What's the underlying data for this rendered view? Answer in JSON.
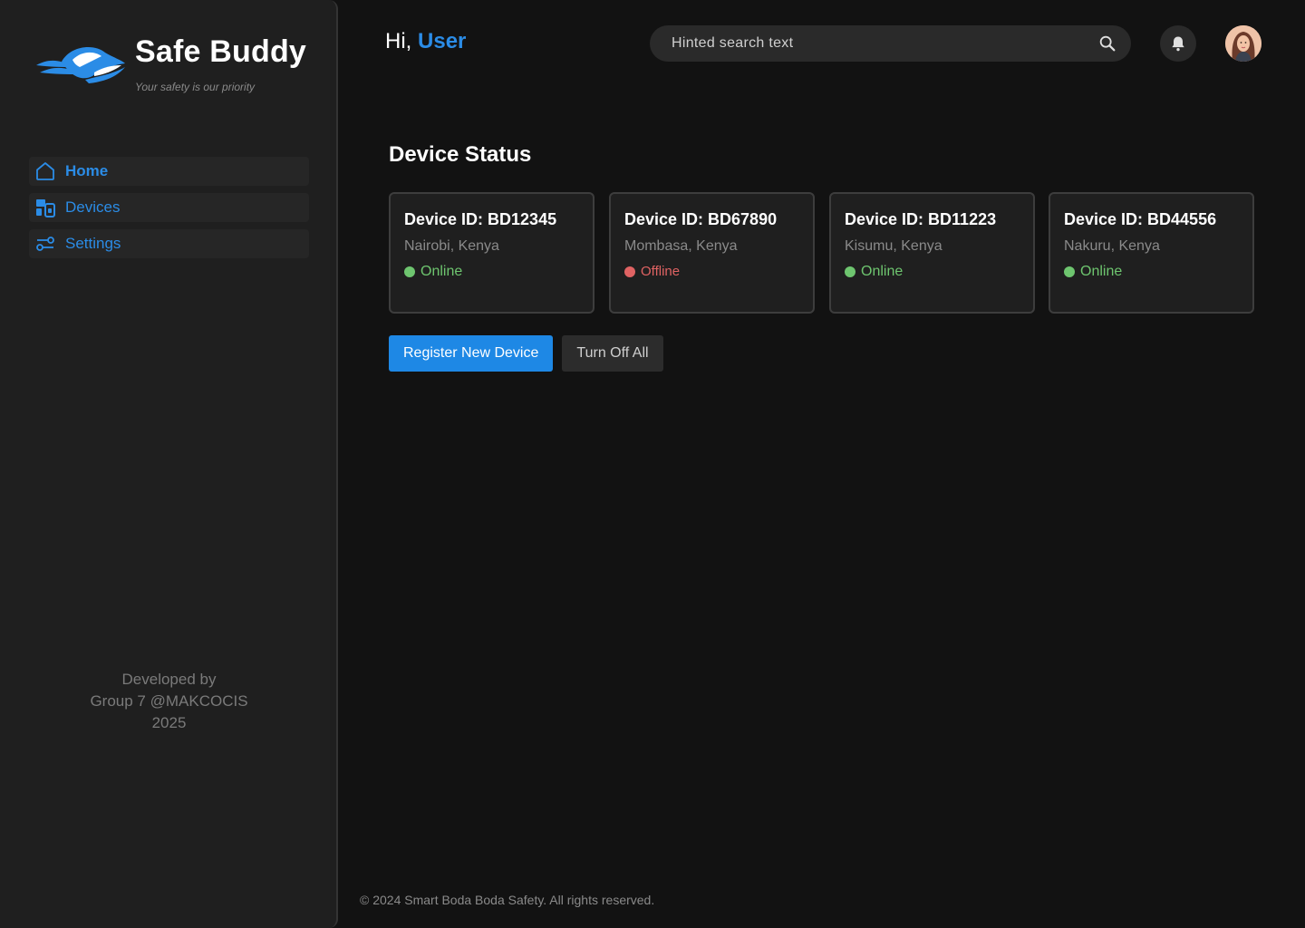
{
  "brand": {
    "name": "Safe Buddy",
    "tagline": "Your safety is our priority"
  },
  "sidebar": {
    "items": [
      {
        "label": "Home",
        "icon": "home-icon",
        "active": true
      },
      {
        "label": "Devices",
        "icon": "devices-icon",
        "active": false
      },
      {
        "label": "Settings",
        "icon": "settings-sliders-icon",
        "active": false
      }
    ],
    "credits": [
      "Developed by",
      "Group 7 @MAKCOCIS",
      "2025"
    ]
  },
  "header": {
    "greeting_prefix": "Hi,",
    "username": "User",
    "search_placeholder": "Hinted search text"
  },
  "main": {
    "section_title": "Device Status",
    "devices": [
      {
        "title": "Device ID: BD12345",
        "location": "Nairobi, Kenya",
        "status": "Online"
      },
      {
        "title": "Device ID: BD67890",
        "location": "Mombasa, Kenya",
        "status": "Offline"
      },
      {
        "title": "Device ID: BD11223",
        "location": "Kisumu, Kenya",
        "status": "Online"
      },
      {
        "title": "Device ID: BD44556",
        "location": "Nakuru, Kenya",
        "status": "Online"
      }
    ],
    "register_button": "Register New Device",
    "turn_off_button": "Turn Off All"
  },
  "footer": {
    "copyright": "© 2024 Smart Boda Boda Safety. All rights reserved."
  },
  "colors": {
    "accent": "#2b8ce6",
    "primary_button": "#1e88e5",
    "online": "#6ec56f",
    "offline": "#e06363",
    "background": "#121212",
    "sidebar": "#1f1f1f"
  }
}
